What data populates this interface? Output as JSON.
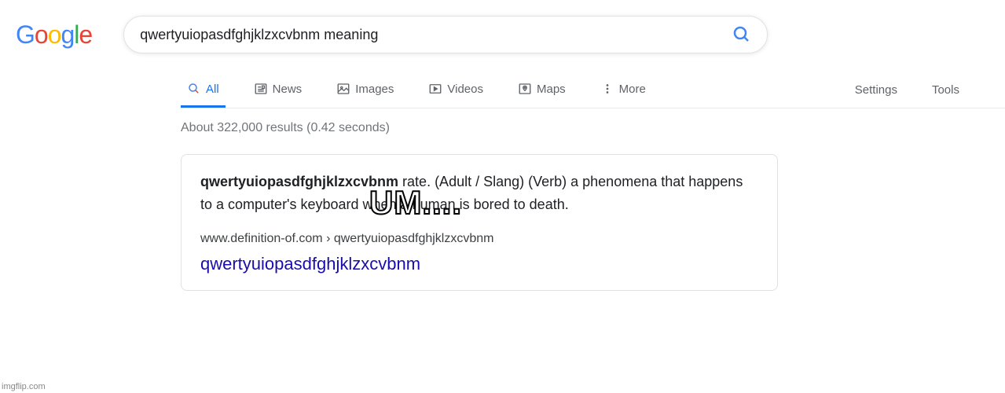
{
  "logo": {
    "g1": "G",
    "o1": "o",
    "o2": "o",
    "g2": "g",
    "l": "l",
    "e": "e"
  },
  "search": {
    "query": "qwertyuiopasdfghjklzxcvbnm meaning"
  },
  "tabs": {
    "all": "All",
    "news": "News",
    "images": "Images",
    "videos": "Videos",
    "maps": "Maps",
    "more": "More",
    "settings": "Settings",
    "tools": "Tools"
  },
  "results": {
    "stats": "About 322,000 results (0.42 seconds)"
  },
  "snippet": {
    "bold_word": "qwertyuiopasdfghjklzxcvbnm",
    "rest_text": " rate. (Adult / Slang) (Verb) a phenomena that happens to a computer's keyboard when a human is bored to death.",
    "url": "www.definition-of.com › qwertyuiopasdfghjklzxcvbnm",
    "title": "qwertyuiopasdfghjklzxcvbnm"
  },
  "meme": {
    "text": "UM...."
  },
  "watermark": "imgflip.com"
}
